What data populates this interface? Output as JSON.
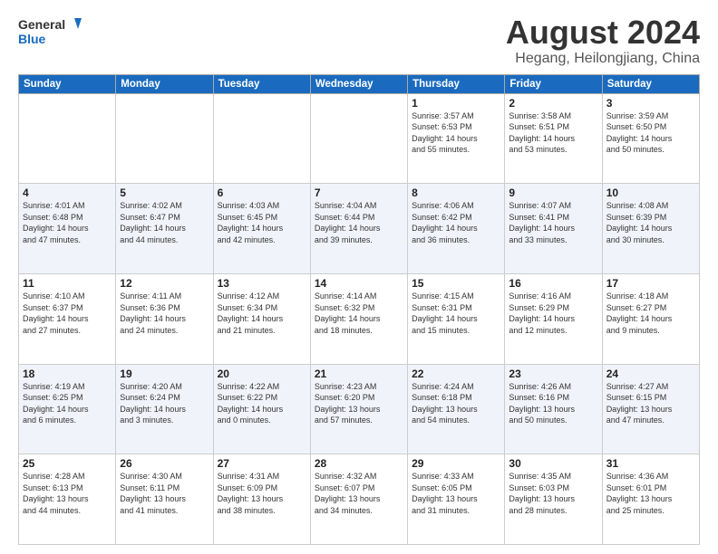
{
  "header": {
    "logo_line1": "General",
    "logo_line2": "Blue",
    "month": "August 2024",
    "location": "Hegang, Heilongjiang, China"
  },
  "weekdays": [
    "Sunday",
    "Monday",
    "Tuesday",
    "Wednesday",
    "Thursday",
    "Friday",
    "Saturday"
  ],
  "weeks": [
    [
      {
        "day": "",
        "info": ""
      },
      {
        "day": "",
        "info": ""
      },
      {
        "day": "",
        "info": ""
      },
      {
        "day": "",
        "info": ""
      },
      {
        "day": "1",
        "info": "Sunrise: 3:57 AM\nSunset: 6:53 PM\nDaylight: 14 hours\nand 55 minutes."
      },
      {
        "day": "2",
        "info": "Sunrise: 3:58 AM\nSunset: 6:51 PM\nDaylight: 14 hours\nand 53 minutes."
      },
      {
        "day": "3",
        "info": "Sunrise: 3:59 AM\nSunset: 6:50 PM\nDaylight: 14 hours\nand 50 minutes."
      }
    ],
    [
      {
        "day": "4",
        "info": "Sunrise: 4:01 AM\nSunset: 6:48 PM\nDaylight: 14 hours\nand 47 minutes."
      },
      {
        "day": "5",
        "info": "Sunrise: 4:02 AM\nSunset: 6:47 PM\nDaylight: 14 hours\nand 44 minutes."
      },
      {
        "day": "6",
        "info": "Sunrise: 4:03 AM\nSunset: 6:45 PM\nDaylight: 14 hours\nand 42 minutes."
      },
      {
        "day": "7",
        "info": "Sunrise: 4:04 AM\nSunset: 6:44 PM\nDaylight: 14 hours\nand 39 minutes."
      },
      {
        "day": "8",
        "info": "Sunrise: 4:06 AM\nSunset: 6:42 PM\nDaylight: 14 hours\nand 36 minutes."
      },
      {
        "day": "9",
        "info": "Sunrise: 4:07 AM\nSunset: 6:41 PM\nDaylight: 14 hours\nand 33 minutes."
      },
      {
        "day": "10",
        "info": "Sunrise: 4:08 AM\nSunset: 6:39 PM\nDaylight: 14 hours\nand 30 minutes."
      }
    ],
    [
      {
        "day": "11",
        "info": "Sunrise: 4:10 AM\nSunset: 6:37 PM\nDaylight: 14 hours\nand 27 minutes."
      },
      {
        "day": "12",
        "info": "Sunrise: 4:11 AM\nSunset: 6:36 PM\nDaylight: 14 hours\nand 24 minutes."
      },
      {
        "day": "13",
        "info": "Sunrise: 4:12 AM\nSunset: 6:34 PM\nDaylight: 14 hours\nand 21 minutes."
      },
      {
        "day": "14",
        "info": "Sunrise: 4:14 AM\nSunset: 6:32 PM\nDaylight: 14 hours\nand 18 minutes."
      },
      {
        "day": "15",
        "info": "Sunrise: 4:15 AM\nSunset: 6:31 PM\nDaylight: 14 hours\nand 15 minutes."
      },
      {
        "day": "16",
        "info": "Sunrise: 4:16 AM\nSunset: 6:29 PM\nDaylight: 14 hours\nand 12 minutes."
      },
      {
        "day": "17",
        "info": "Sunrise: 4:18 AM\nSunset: 6:27 PM\nDaylight: 14 hours\nand 9 minutes."
      }
    ],
    [
      {
        "day": "18",
        "info": "Sunrise: 4:19 AM\nSunset: 6:25 PM\nDaylight: 14 hours\nand 6 minutes."
      },
      {
        "day": "19",
        "info": "Sunrise: 4:20 AM\nSunset: 6:24 PM\nDaylight: 14 hours\nand 3 minutes."
      },
      {
        "day": "20",
        "info": "Sunrise: 4:22 AM\nSunset: 6:22 PM\nDaylight: 14 hours\nand 0 minutes."
      },
      {
        "day": "21",
        "info": "Sunrise: 4:23 AM\nSunset: 6:20 PM\nDaylight: 13 hours\nand 57 minutes."
      },
      {
        "day": "22",
        "info": "Sunrise: 4:24 AM\nSunset: 6:18 PM\nDaylight: 13 hours\nand 54 minutes."
      },
      {
        "day": "23",
        "info": "Sunrise: 4:26 AM\nSunset: 6:16 PM\nDaylight: 13 hours\nand 50 minutes."
      },
      {
        "day": "24",
        "info": "Sunrise: 4:27 AM\nSunset: 6:15 PM\nDaylight: 13 hours\nand 47 minutes."
      }
    ],
    [
      {
        "day": "25",
        "info": "Sunrise: 4:28 AM\nSunset: 6:13 PM\nDaylight: 13 hours\nand 44 minutes."
      },
      {
        "day": "26",
        "info": "Sunrise: 4:30 AM\nSunset: 6:11 PM\nDaylight: 13 hours\nand 41 minutes."
      },
      {
        "day": "27",
        "info": "Sunrise: 4:31 AM\nSunset: 6:09 PM\nDaylight: 13 hours\nand 38 minutes."
      },
      {
        "day": "28",
        "info": "Sunrise: 4:32 AM\nSunset: 6:07 PM\nDaylight: 13 hours\nand 34 minutes."
      },
      {
        "day": "29",
        "info": "Sunrise: 4:33 AM\nSunset: 6:05 PM\nDaylight: 13 hours\nand 31 minutes."
      },
      {
        "day": "30",
        "info": "Sunrise: 4:35 AM\nSunset: 6:03 PM\nDaylight: 13 hours\nand 28 minutes."
      },
      {
        "day": "31",
        "info": "Sunrise: 4:36 AM\nSunset: 6:01 PM\nDaylight: 13 hours\nand 25 minutes."
      }
    ]
  ]
}
